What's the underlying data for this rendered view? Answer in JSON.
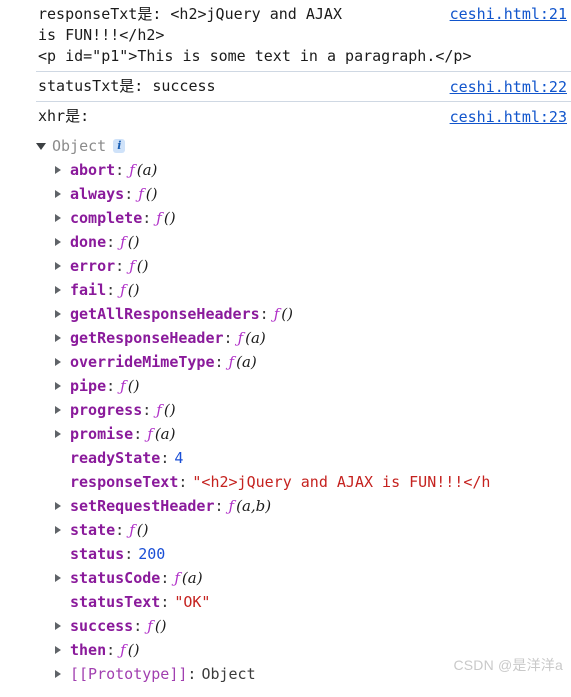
{
  "console": {
    "entries": [
      {
        "text": "responseTxt是: <h2>jQuery and AJAX\nis FUN!!!</h2>\n<p id=\"p1\">This is some text in a paragraph.</p>",
        "source": "ceshi.html:21"
      },
      {
        "text": "statusTxt是: success",
        "source": "ceshi.html:22"
      },
      {
        "text": "xhr是:",
        "source": "ceshi.html:23"
      }
    ],
    "object_tree": {
      "root_label": "Object",
      "info_badge": "i",
      "expanded": true,
      "properties": [
        {
          "key": "abort",
          "kind": "function",
          "fn": "ƒ",
          "args": "(a)",
          "expandable": true
        },
        {
          "key": "always",
          "kind": "function",
          "fn": "ƒ",
          "args": "()",
          "expandable": true
        },
        {
          "key": "complete",
          "kind": "function",
          "fn": "ƒ",
          "args": "()",
          "expandable": true
        },
        {
          "key": "done",
          "kind": "function",
          "fn": "ƒ",
          "args": "()",
          "expandable": true
        },
        {
          "key": "error",
          "kind": "function",
          "fn": "ƒ",
          "args": "()",
          "expandable": true
        },
        {
          "key": "fail",
          "kind": "function",
          "fn": "ƒ",
          "args": "()",
          "expandable": true
        },
        {
          "key": "getAllResponseHeaders",
          "kind": "function",
          "fn": "ƒ",
          "args": "()",
          "expandable": true
        },
        {
          "key": "getResponseHeader",
          "kind": "function",
          "fn": "ƒ",
          "args": "(a)",
          "expandable": true
        },
        {
          "key": "overrideMimeType",
          "kind": "function",
          "fn": "ƒ",
          "args": "(a)",
          "expandable": true
        },
        {
          "key": "pipe",
          "kind": "function",
          "fn": "ƒ",
          "args": "()",
          "expandable": true
        },
        {
          "key": "progress",
          "kind": "function",
          "fn": "ƒ",
          "args": "()",
          "expandable": true
        },
        {
          "key": "promise",
          "kind": "function",
          "fn": "ƒ",
          "args": "(a)",
          "expandable": true
        },
        {
          "key": "readyState",
          "kind": "number",
          "value": "4",
          "expandable": false
        },
        {
          "key": "responseText",
          "kind": "string",
          "value": "\"<h2>jQuery and AJAX is FUN!!!</h",
          "expandable": false
        },
        {
          "key": "setRequestHeader",
          "kind": "function",
          "fn": "ƒ",
          "args": "(a,b)",
          "expandable": true
        },
        {
          "key": "state",
          "kind": "function",
          "fn": "ƒ",
          "args": "()",
          "expandable": true
        },
        {
          "key": "status",
          "kind": "number",
          "value": "200",
          "expandable": false
        },
        {
          "key": "statusCode",
          "kind": "function",
          "fn": "ƒ",
          "args": "(a)",
          "expandable": true
        },
        {
          "key": "statusText",
          "kind": "string",
          "value": "\"OK\"",
          "expandable": false
        },
        {
          "key": "success",
          "kind": "function",
          "fn": "ƒ",
          "args": "()",
          "expandable": true
        },
        {
          "key": "then",
          "kind": "function",
          "fn": "ƒ",
          "args": "()",
          "expandable": true
        },
        {
          "key": "[[Prototype]]",
          "kind": "object",
          "value": "Object",
          "expandable": true,
          "plain_key": true
        }
      ]
    }
  },
  "watermark": "CSDN @是洋洋a",
  "colors": {
    "link": "#1155cc",
    "key": "#8a1a9b",
    "function": "#b030c8",
    "number": "#1a4fd6",
    "string": "#c5221f",
    "divider": "#cfd8e3",
    "badge_bg": "#cfe2f9"
  }
}
